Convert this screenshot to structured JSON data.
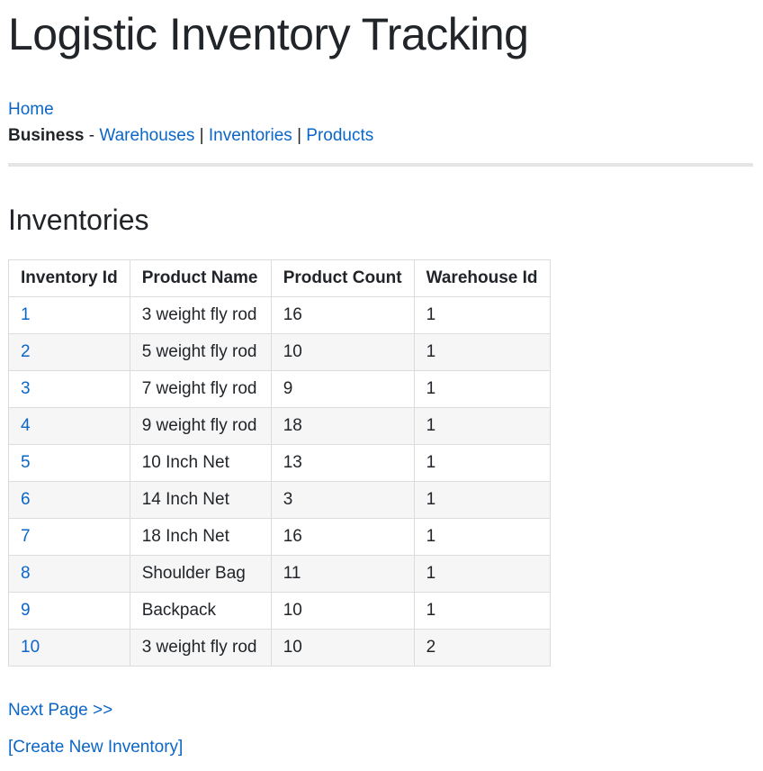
{
  "site": {
    "title": "Logistic Inventory Tracking"
  },
  "nav": {
    "home": "Home",
    "business_label": "Business",
    "dash": " - ",
    "separator": " | ",
    "links": [
      "Warehouses",
      "Inventories",
      "Products"
    ]
  },
  "section": {
    "title": "Inventories"
  },
  "table": {
    "headers": [
      "Inventory Id",
      "Product Name",
      "Product Count",
      "Warehouse Id"
    ],
    "rows": [
      [
        "1",
        "3 weight fly rod",
        "16",
        "1"
      ],
      [
        "2",
        "5 weight fly rod",
        "10",
        "1"
      ],
      [
        "3",
        "7 weight fly rod",
        "9",
        "1"
      ],
      [
        "4",
        "9 weight fly rod",
        "18",
        "1"
      ],
      [
        "5",
        "10 Inch Net",
        "13",
        "1"
      ],
      [
        "6",
        "14 Inch Net",
        "3",
        "1"
      ],
      [
        "7",
        "18 Inch Net",
        "16",
        "1"
      ],
      [
        "8",
        "Shoulder Bag",
        "11",
        "1"
      ],
      [
        "9",
        "Backpack",
        "10",
        "1"
      ],
      [
        "10",
        "3 weight fly rod",
        "10",
        "2"
      ]
    ]
  },
  "pagination": {
    "next_label": "Next Page >>"
  },
  "actions": {
    "create_label": "[Create New Inventory]"
  },
  "colors": {
    "link": "#0b66c7",
    "text": "#212529",
    "row_alt": "#f6f6f6",
    "border": "#dcdcdc"
  }
}
